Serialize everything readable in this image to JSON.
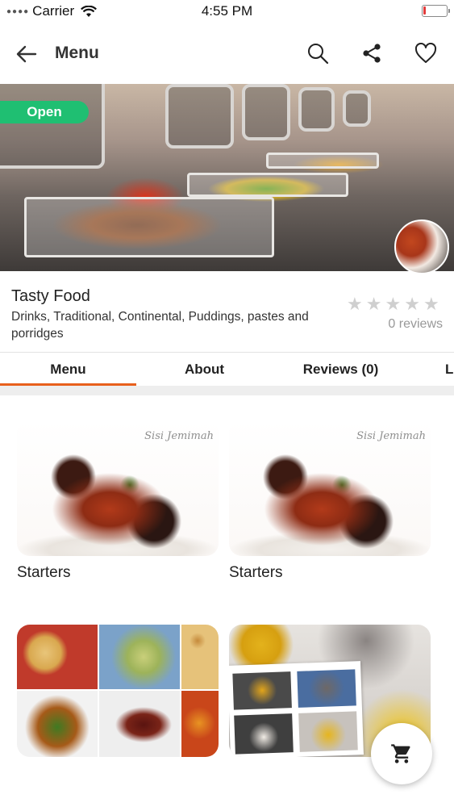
{
  "status_bar": {
    "carrier": "Carrier",
    "time": "4:55 PM",
    "battery_level": 0.1,
    "battery_color": "#e23b3b"
  },
  "header": {
    "title": "Menu",
    "icons": [
      "back-arrow-icon",
      "search-icon",
      "share-icon",
      "heart-icon"
    ]
  },
  "hero": {
    "status_badge": "Open",
    "badge_color": "#1fbf72"
  },
  "restaurant": {
    "name": "Tasty Food",
    "categories": "Drinks, Traditional, Continental, Puddings, pastes and porridges",
    "rating": 0,
    "max_rating": 5,
    "reviews_text": "0 reviews"
  },
  "tabs": {
    "items": [
      {
        "label": "Menu",
        "active": true
      },
      {
        "label": "About",
        "active": false
      },
      {
        "label": "Reviews (0)",
        "active": false
      },
      {
        "label": "L",
        "active": false
      }
    ],
    "accent_color": "#e8601c"
  },
  "menu_categories": [
    {
      "label": "Starters",
      "watermark": "Sisi Jemimah"
    },
    {
      "label": "Starters",
      "watermark": "Sisi Jemimah"
    },
    {
      "label": ""
    },
    {
      "label": ""
    }
  ],
  "cart": {
    "icon": "cart-icon"
  }
}
